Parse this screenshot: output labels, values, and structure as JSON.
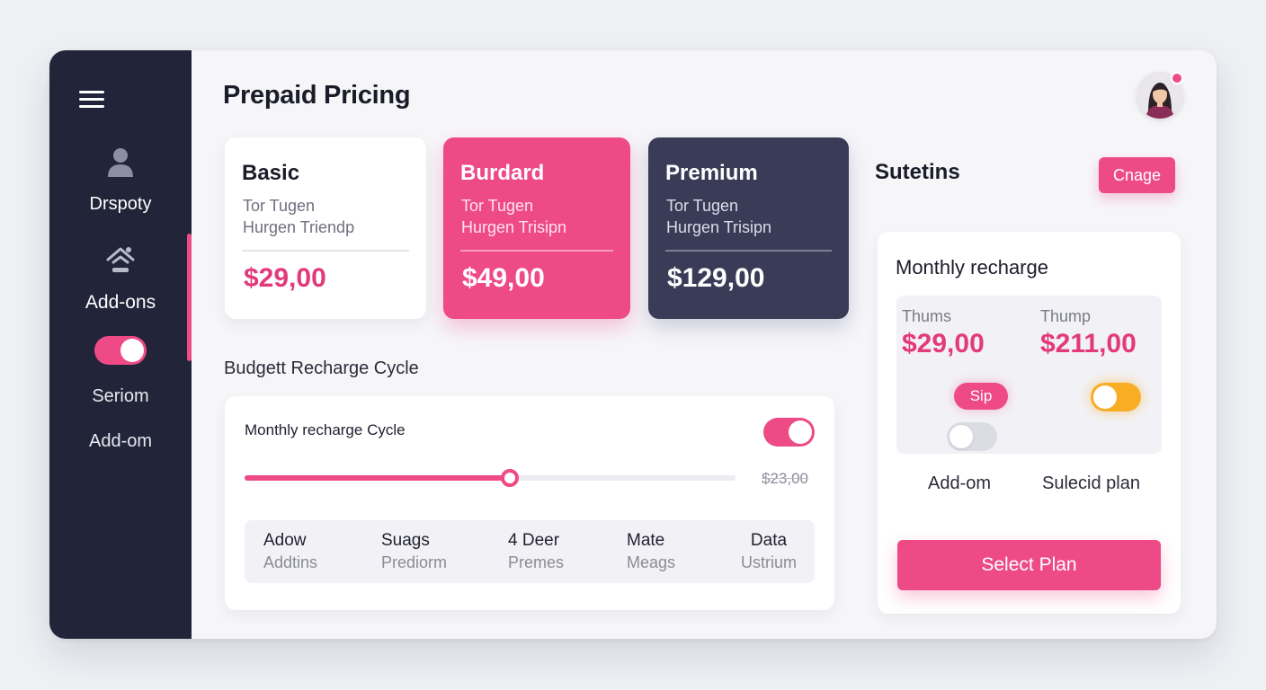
{
  "page": {
    "title": "Prepaid Pricing"
  },
  "sidebar": {
    "items": [
      {
        "label": "Drspoty",
        "icon": "user-icon"
      },
      {
        "label": "Add-ons",
        "icon": "home-icon"
      },
      {
        "label": "Seriom"
      },
      {
        "label": "Add-om"
      }
    ],
    "toggle_on": true
  },
  "plans": [
    {
      "name": "Basic",
      "line1": "Tor Tugen",
      "line2": "Hurgen Triendp",
      "price": "$29,00"
    },
    {
      "name": "Burdard",
      "line1": "Tor Tugen",
      "line2": "Hurgen Trisipn",
      "price": "$49,00"
    },
    {
      "name": "Premium",
      "line1": "Tor Tugen",
      "line2": "Hurgen Trisipn",
      "price": "$129,00"
    }
  ],
  "budget": {
    "section_label": "Budgett Recharge Cycle",
    "title": "Monthly recharge Cycle",
    "toggle_on": true,
    "slider_fraction": 0.54,
    "slider_value": "$23,00",
    "addons": [
      {
        "title": "Adow",
        "sub": "Addtins"
      },
      {
        "title": "Suags",
        "sub": "Prediorm"
      },
      {
        "title": "4 Deer",
        "sub": "Premes"
      },
      {
        "title": "Mate",
        "sub": "Meags"
      },
      {
        "title": "Data",
        "sub": "Ustrium"
      }
    ]
  },
  "right": {
    "title": "Sutetins",
    "change_label": "Cnage",
    "recharge_title": "Monthly recharge",
    "col1_label": "Thums",
    "col1_value": "$29,00",
    "col2_label": "Thump",
    "col2_value": "$211,00",
    "skip_label": "Sip",
    "orange_toggle_on": false,
    "gray_toggle_on": false,
    "addon_label": "Add-om",
    "selected_label": "Sulecid plan",
    "select_button": "Select Plan"
  },
  "colors": {
    "accent": "#ee4a86",
    "sidebar": "#22243a",
    "premium": "#393b57",
    "orange": "#f8ad25"
  }
}
